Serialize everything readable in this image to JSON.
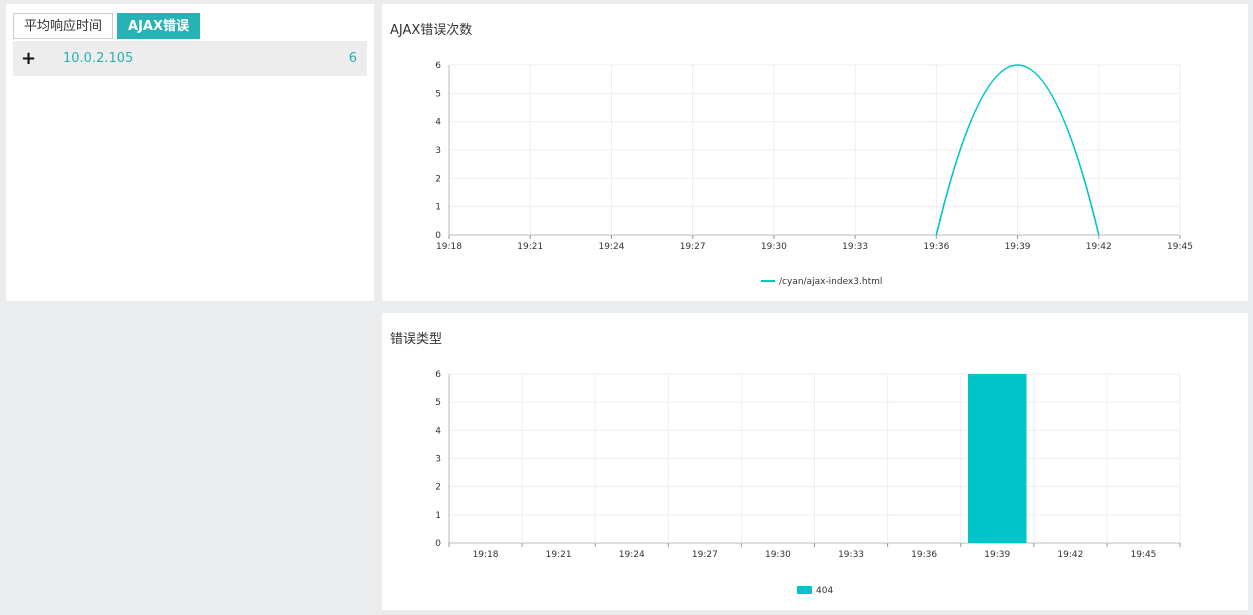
{
  "left": {
    "tabs": [
      {
        "label": "平均响应时间",
        "active": false
      },
      {
        "label": "AJAX错误",
        "active": true
      }
    ],
    "rows": [
      {
        "expand_symbol": "+",
        "ip": "10.0.2.105",
        "count": "6"
      }
    ]
  },
  "colors": {
    "accent": "#27b2b6",
    "series": "#00c5c8"
  },
  "chart_data": [
    {
      "type": "line",
      "title": "AJAX错误次数",
      "x": [
        "19:18",
        "19:21",
        "19:24",
        "19:27",
        "19:30",
        "19:33",
        "19:36",
        "19:39",
        "19:42",
        "19:45"
      ],
      "series": [
        {
          "name": "/cyan/ajax-index3.html",
          "values": [
            0,
            0,
            0,
            0,
            0,
            0,
            0,
            6,
            0,
            null
          ]
        }
      ],
      "ylim": [
        0,
        6
      ],
      "yticks": [
        "0",
        "1",
        "2",
        "3",
        "4",
        "5",
        "6"
      ],
      "grid": true,
      "legend": "bottom-center"
    },
    {
      "type": "bar",
      "title": "错误类型",
      "categories": [
        "19:18",
        "19:21",
        "19:24",
        "19:27",
        "19:30",
        "19:33",
        "19:36",
        "19:39",
        "19:42",
        "19:45"
      ],
      "series": [
        {
          "name": "404",
          "values": [
            0,
            0,
            0,
            0,
            0,
            0,
            0,
            6,
            0,
            0
          ]
        }
      ],
      "ylim": [
        0,
        6
      ],
      "yticks": [
        "0",
        "1",
        "2",
        "3",
        "4",
        "5",
        "6"
      ],
      "grid": true,
      "legend": "bottom-center"
    }
  ]
}
